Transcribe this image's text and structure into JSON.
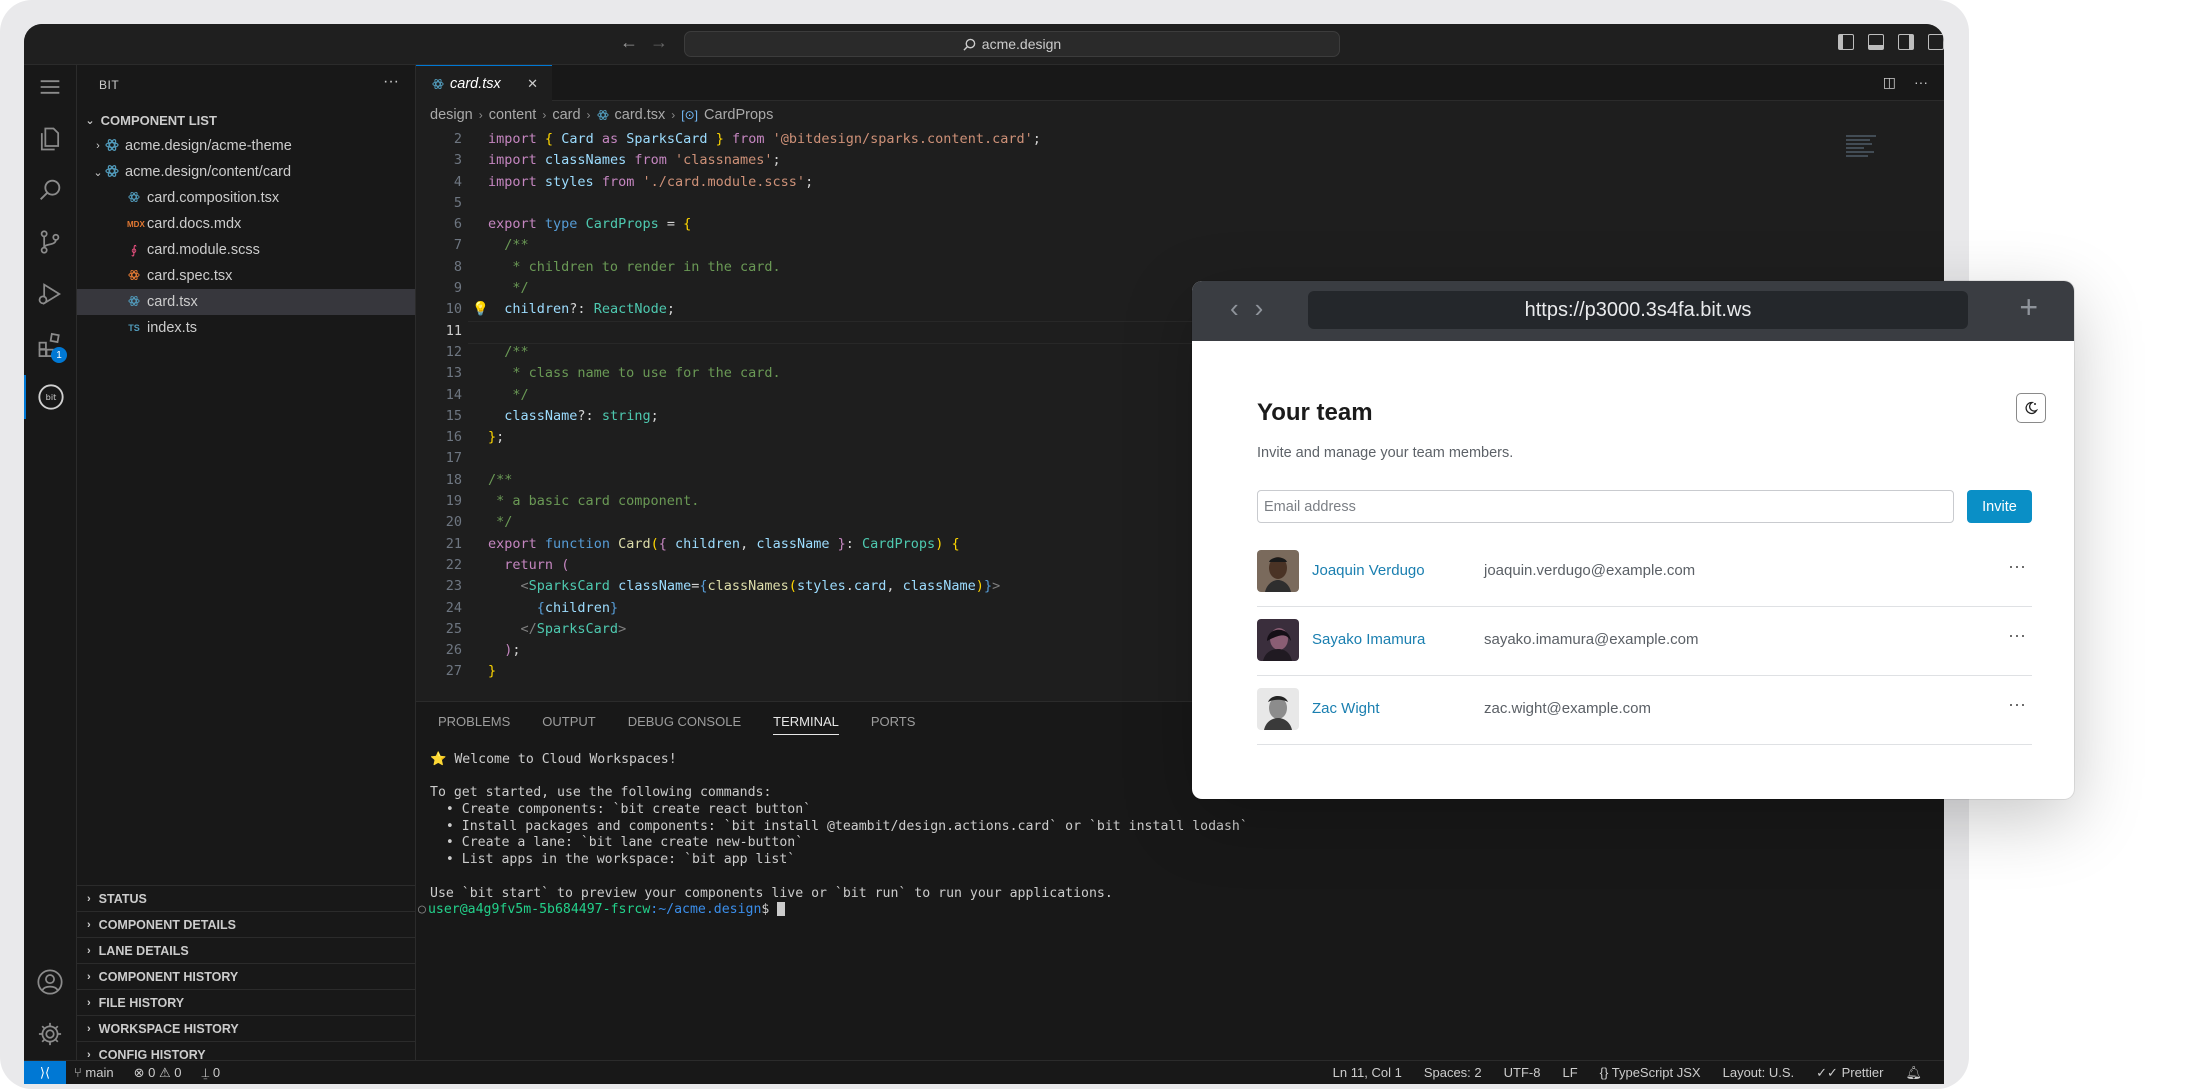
{
  "titlebar": {
    "search_text": "acme.design"
  },
  "sidebar": {
    "title": "BIT",
    "section": "COMPONENT LIST",
    "items": [
      {
        "label": "acme.design/acme-theme",
        "kind": "component",
        "icon": "component-icon"
      },
      {
        "label": "acme.design/content/card",
        "kind": "component",
        "icon": "component-icon"
      },
      {
        "label": "card.composition.tsx",
        "kind": "file",
        "icon": "react-icon"
      },
      {
        "label": "card.docs.mdx",
        "kind": "file",
        "icon": "mdx-icon",
        "icon_text": "MDX"
      },
      {
        "label": "card.module.scss",
        "kind": "file",
        "icon": "sass-icon"
      },
      {
        "label": "card.spec.tsx",
        "kind": "file",
        "icon": "react-icon"
      },
      {
        "label": "card.tsx",
        "kind": "file",
        "icon": "react-icon"
      },
      {
        "label": "index.ts",
        "kind": "file",
        "icon": "typescript-icon",
        "icon_text": "TS"
      }
    ],
    "bottom_sections": [
      "STATUS",
      "COMPONENT DETAILS",
      "LANE DETAILS",
      "COMPONENT HISTORY",
      "FILE HISTORY",
      "WORKSPACE HISTORY",
      "CONFIG HISTORY"
    ]
  },
  "activity": {
    "extensions_badge": "1",
    "bit_label": "bit"
  },
  "editor": {
    "tab_label": "card.tsx",
    "breadcrumbs": [
      "design",
      "content",
      "card",
      "card.tsx",
      "CardProps"
    ],
    "line_numbers": [
      "2",
      "3",
      "4",
      "5",
      "6",
      "7",
      "8",
      "9",
      "10",
      "11",
      "12",
      "13",
      "14",
      "15",
      "16",
      "17",
      "18",
      "19",
      "20",
      "21",
      "22",
      "23",
      "24",
      "25",
      "26",
      "27"
    ],
    "current_line": "11"
  },
  "panel": {
    "tabs": [
      "PROBLEMS",
      "OUTPUT",
      "DEBUG CONSOLE",
      "TERMINAL",
      "PORTS"
    ],
    "active_tab": "TERMINAL",
    "terminal": {
      "welcome": "⭐ Welcome to Cloud Workspaces!",
      "intro": "To get started, use the following commands:",
      "commands": [
        "  • Create components: `bit create react button`",
        "  • Install packages and components: `bit install @teambit/design.actions.card` or `bit install lodash`",
        "  • Create a lane: `bit lane create new-button`",
        "  • List apps in the workspace: `bit app list`"
      ],
      "outro": "Use `bit start` to preview your components live or `bit run` to run your applications.",
      "prompt_user": "user@a4g9fv5m-5b684497-fsrcw",
      "prompt_path": ":~/acme.design",
      "prompt_symbol": "$"
    }
  },
  "statusbar": {
    "branch": "main",
    "problems": "⊗ 0 ⚠ 0",
    "ports": "0",
    "position": "Ln 11, Col 1",
    "spaces": "Spaces: 2",
    "encoding": "UTF-8",
    "eol": "LF",
    "language": "TypeScript JSX",
    "layout": "Layout: U.S.",
    "prettier": "Prettier"
  },
  "browser": {
    "url": "https://p3000.3s4fa.bit.ws",
    "title": "Your team",
    "subtitle": "Invite and manage your team members.",
    "email_placeholder": "Email address",
    "invite_label": "Invite",
    "members": [
      {
        "name": "Joaquin Verdugo",
        "email": "joaquin.verdugo@example.com"
      },
      {
        "name": "Sayako Imamura",
        "email": "sayako.imamura@example.com"
      },
      {
        "name": "Zac Wight",
        "email": "zac.wight@example.com"
      }
    ],
    "more_label": "···"
  },
  "colors": {
    "accent": "#0078d4",
    "invite_button": "#0a8fc6",
    "member_link": "#1a7fb0",
    "editor_bg": "#1e1e1e"
  }
}
